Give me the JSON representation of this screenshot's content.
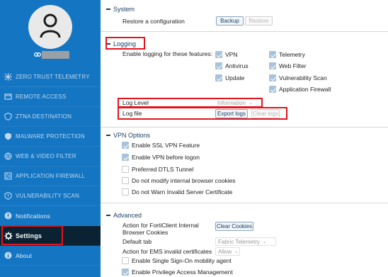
{
  "sidebar": {
    "nav": [
      {
        "label": "ZERO TRUST TELEMETRY",
        "icon": "zero-trust-icon"
      },
      {
        "label": "REMOTE ACCESS",
        "icon": "remote-access-icon"
      },
      {
        "label": "ZTNA DESTINATION",
        "icon": "ztna-icon"
      },
      {
        "label": "MALWARE PROTECTION",
        "icon": "malware-icon"
      },
      {
        "label": "WEB & VIDEO FILTER",
        "icon": "web-filter-icon"
      },
      {
        "label": "APPLICATION FIREWALL",
        "icon": "app-firewall-icon"
      },
      {
        "label": "VULNERABILITY SCAN",
        "icon": "vuln-scan-icon"
      },
      {
        "label": "Notifications",
        "icon": "notification-icon"
      },
      {
        "label": "Settings",
        "icon": "gear-icon"
      },
      {
        "label": "About",
        "icon": "info-icon"
      }
    ],
    "active": "Settings"
  },
  "system": {
    "title": "System",
    "restore_label": "Restore a configuration",
    "backup_button": "Backup",
    "restore_button": "Restore"
  },
  "logging": {
    "title": "Logging",
    "enable_label": "Enable logging for these features:",
    "features": [
      {
        "label": "VPN",
        "checked": true
      },
      {
        "label": "Telemetry",
        "checked": true
      },
      {
        "label": "Antivirus",
        "checked": true
      },
      {
        "label": "Web Filter",
        "checked": true
      },
      {
        "label": "Update",
        "checked": true
      },
      {
        "label": "Vulnerability Scan",
        "checked": true
      },
      {
        "label": "Application Firewall",
        "checked": true
      }
    ],
    "log_level_label": "Log Level",
    "log_level_value": "Information",
    "log_file_label": "Log file",
    "export_button": "Export logs",
    "clear_button": "Clear logs"
  },
  "vpn": {
    "title": "VPN Options",
    "options": [
      {
        "label": "Enable SSL VPN Feature",
        "checked": true
      },
      {
        "label": "Enable VPN before logon",
        "checked": true
      },
      {
        "label": "Preferred DTLS Tunnel",
        "checked": false
      },
      {
        "label": "Do not modify internal browser cookies",
        "checked": false
      },
      {
        "label": "Do not Warn Invalid Server Certificate",
        "checked": false
      }
    ]
  },
  "advanced": {
    "title": "Advanced",
    "cookies_label_1": "Action for FortiClient Internal",
    "cookies_label_2": "Browser Cookies",
    "clear_cookies_button": "Clear Cookies",
    "default_tab_label": "Default tab",
    "default_tab_value": "Fabric Telemetry",
    "ems_label": "Action for EMS invalid certificates",
    "ems_value": "Allow",
    "sso_label": "Enable Single Sign-On mobility agent",
    "sso_checked": false,
    "pam_label": "Enable Privilege Access Management",
    "pam_checked": true
  },
  "colors": {
    "sidebar_bg": "#1475c3",
    "active_bg": "#0b2233",
    "highlight": "#e5141c"
  }
}
